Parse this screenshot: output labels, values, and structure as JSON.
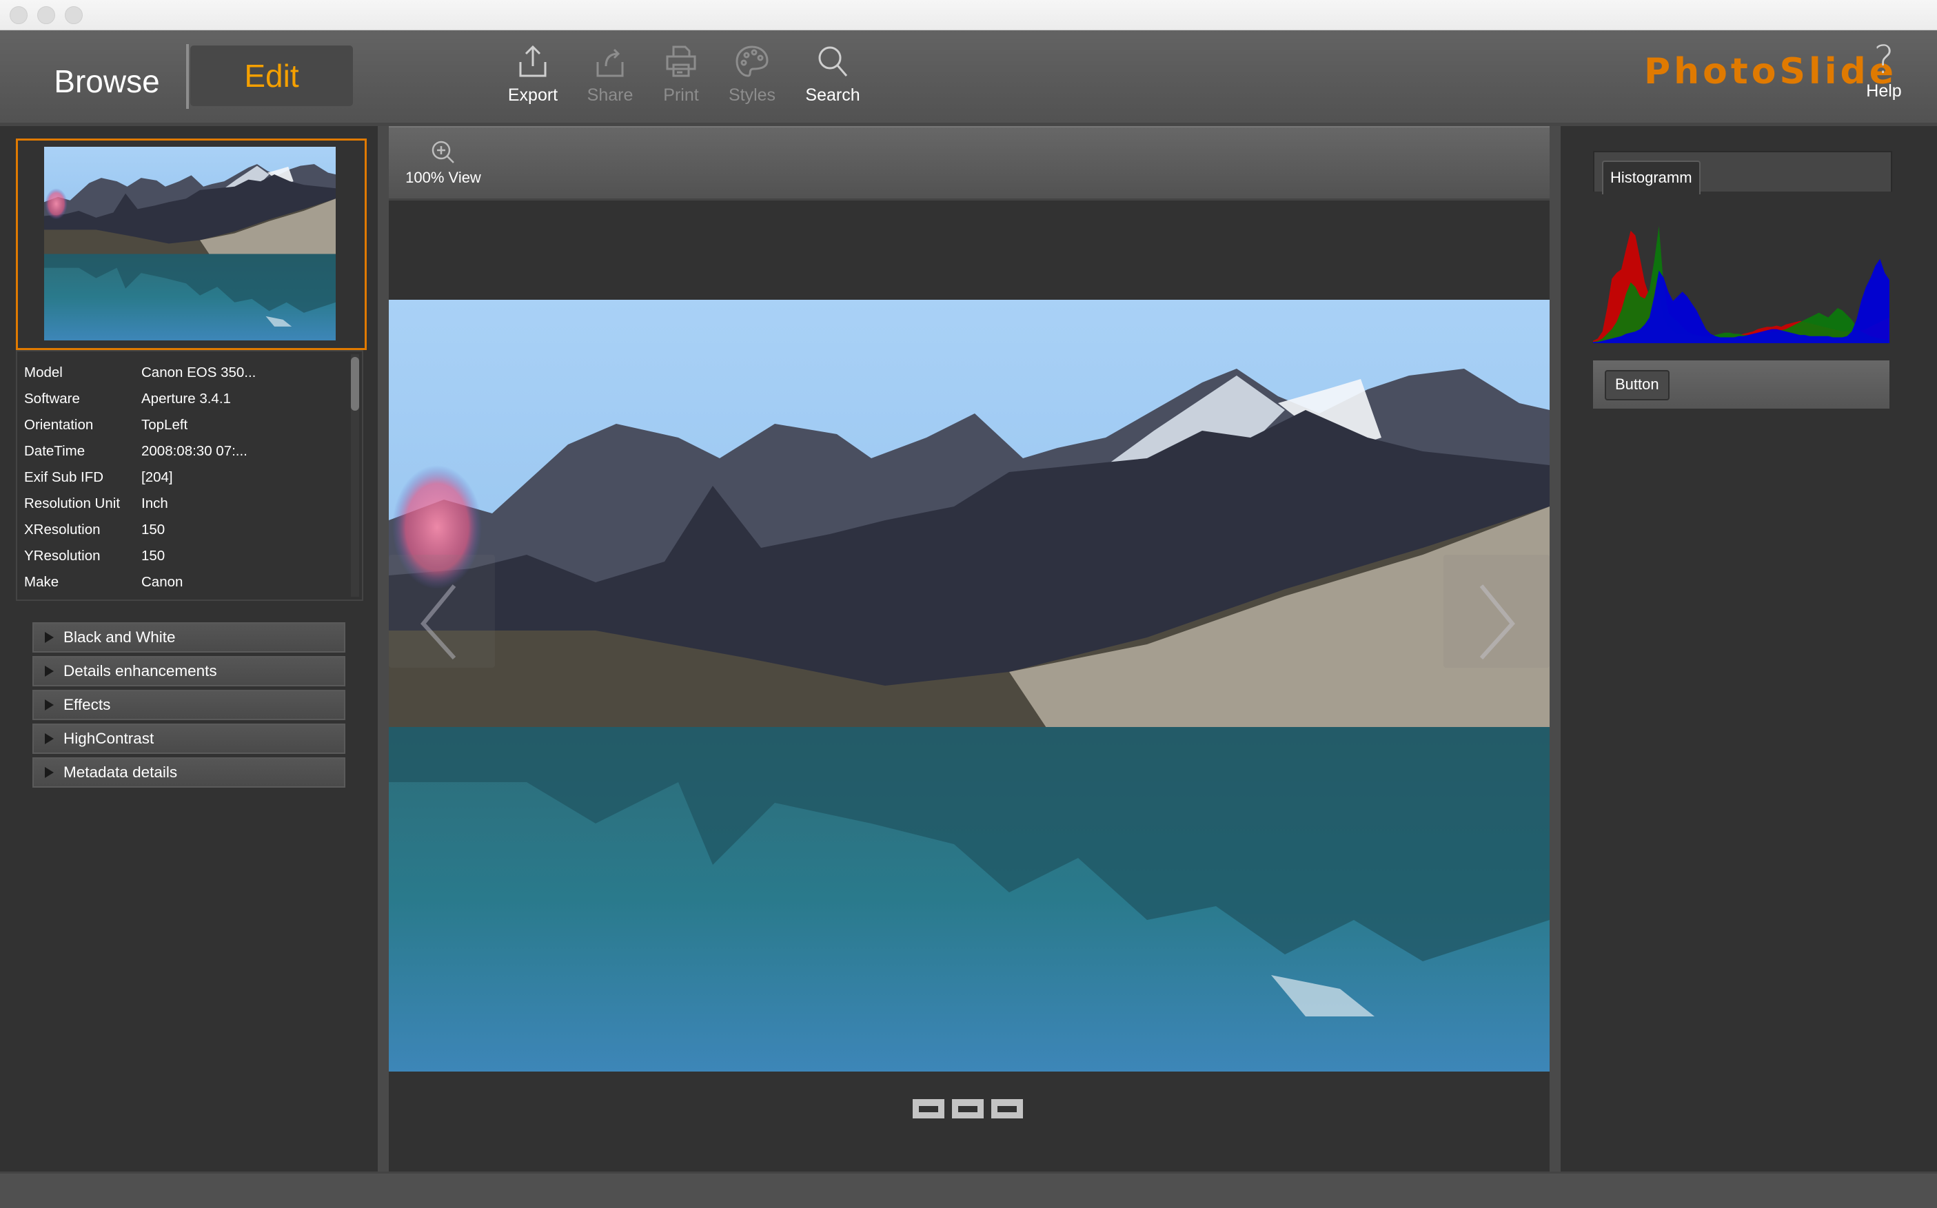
{
  "window": {
    "title_bar_buttons": [
      "close",
      "minimize",
      "zoom"
    ]
  },
  "toolbar": {
    "modes": {
      "browse": "Browse",
      "edit": "Edit",
      "active": "edit"
    },
    "tools": [
      {
        "id": "export",
        "label": "Export",
        "icon": "export-icon",
        "enabled": true
      },
      {
        "id": "share",
        "label": "Share",
        "icon": "share-icon",
        "enabled": false
      },
      {
        "id": "print",
        "label": "Print",
        "icon": "printer-icon",
        "enabled": false
      },
      {
        "id": "styles",
        "label": "Styles",
        "icon": "palette-icon",
        "enabled": false
      },
      {
        "id": "search",
        "label": "Search",
        "icon": "search-icon",
        "enabled": true
      }
    ],
    "brand": "PhotoSlide",
    "help": {
      "label": "Help",
      "glyph": "?"
    }
  },
  "colors": {
    "accent": "#e07a00",
    "edit_active": "#f5a000",
    "panel_bg": "#323232",
    "toolbar_bg": "#5a5a5a"
  },
  "left_panel": {
    "metadata": [
      {
        "key": "Model",
        "value": "Canon EOS 350..."
      },
      {
        "key": "Software",
        "value": "Aperture 3.4.1"
      },
      {
        "key": "Orientation",
        "value": "TopLeft"
      },
      {
        "key": "DateTime",
        "value": "2008:08:30 07:..."
      },
      {
        "key": "Exif Sub IFD",
        "value": "[204]"
      },
      {
        "key": "Resolution Unit",
        "value": "Inch"
      },
      {
        "key": "XResolution",
        "value": "150"
      },
      {
        "key": "YResolution",
        "value": "150"
      },
      {
        "key": "Make",
        "value": "Canon"
      }
    ],
    "sections": [
      {
        "label": "Black and White",
        "expanded": false
      },
      {
        "label": "Details enhancements",
        "expanded": false
      },
      {
        "label": "Effects",
        "expanded": false
      },
      {
        "label": "HighContrast",
        "expanded": false
      },
      {
        "label": "Metadata details",
        "expanded": false
      }
    ]
  },
  "center": {
    "view_button": {
      "label": "100% View",
      "icon": "zoom-in-icon"
    },
    "photo": {
      "subject": "Alpine lake reflecting mountains"
    },
    "pager": {
      "count": 3
    }
  },
  "right_panel": {
    "tab": "Histogramm",
    "button_label": "Button",
    "histogram": {
      "channels": {
        "red": [
          2,
          4,
          10,
          30,
          55,
          60,
          63,
          80,
          96,
          92,
          72,
          52,
          40,
          54,
          44,
          22,
          14,
          10,
          8,
          8,
          7,
          7,
          6,
          6,
          5,
          5,
          5,
          5,
          5,
          6,
          6,
          7,
          8,
          9,
          10,
          12,
          13,
          14,
          14,
          15,
          14,
          16,
          17,
          18,
          19,
          18,
          17,
          16,
          15,
          14,
          13,
          12,
          11,
          10,
          10,
          10,
          10,
          11,
          12,
          14,
          16,
          18,
          20,
          22
        ],
        "green": [
          1,
          2,
          4,
          8,
          12,
          18,
          28,
          42,
          52,
          48,
          40,
          38,
          46,
          70,
          100,
          50,
          26,
          22,
          18,
          14,
          10,
          8,
          7,
          6,
          6,
          6,
          7,
          8,
          9,
          9,
          8,
          8,
          7,
          7,
          7,
          8,
          8,
          9,
          10,
          10,
          11,
          12,
          14,
          16,
          18,
          20,
          22,
          24,
          26,
          24,
          22,
          26,
          30,
          28,
          24,
          20,
          14,
          10,
          8,
          6,
          5,
          4,
          3,
          2
        ],
        "blue": [
          1,
          1,
          2,
          3,
          4,
          5,
          6,
          8,
          9,
          10,
          12,
          16,
          22,
          40,
          62,
          56,
          44,
          36,
          40,
          44,
          40,
          34,
          28,
          20,
          12,
          8,
          6,
          5,
          5,
          5,
          5,
          6,
          6,
          7,
          8,
          9,
          10,
          11,
          12,
          12,
          11,
          10,
          9,
          8,
          7,
          7,
          6,
          6,
          6,
          6,
          6,
          5,
          5,
          5,
          6,
          10,
          20,
          36,
          48,
          56,
          66,
          72,
          60,
          54
        ]
      },
      "colors": {
        "red": "#d00000",
        "green": "#0a7a0a",
        "blue": "#0000d8"
      }
    }
  }
}
